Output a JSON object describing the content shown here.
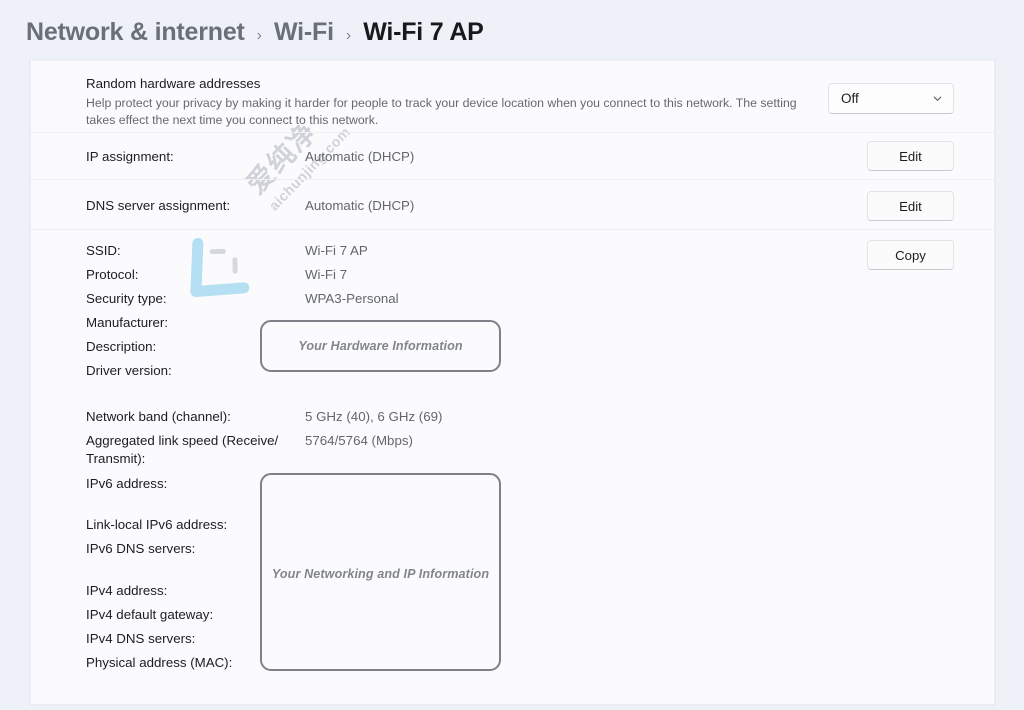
{
  "breadcrumb": {
    "items": [
      {
        "label": "Network & internet",
        "current": false
      },
      {
        "label": "Wi-Fi",
        "current": false
      },
      {
        "label": "Wi-Fi 7 AP",
        "current": true
      }
    ],
    "separator": "›"
  },
  "random_hardware": {
    "title": "Random hardware addresses",
    "description": "Help protect your privacy by making it harder for people to track your device location when you connect to this network. The setting takes effect the next time you connect to this network.",
    "dropdown_value": "Off",
    "dropdown_icon": "chevron-down-icon"
  },
  "rows": {
    "ip_assignment": {
      "label": "IP assignment:",
      "value": "Automatic (DHCP)",
      "button": "Edit"
    },
    "dns_assignment": {
      "label": "DNS server assignment:",
      "value": "Automatic (DHCP)",
      "button": "Edit"
    },
    "copy_button": "Copy",
    "ssid": {
      "label": "SSID:",
      "value": "Wi-Fi 7 AP"
    },
    "protocol": {
      "label": "Protocol:",
      "value": "Wi-Fi 7"
    },
    "security_type": {
      "label": "Security type:",
      "value": "WPA3-Personal"
    },
    "manufacturer": {
      "label": "Manufacturer:",
      "value": ""
    },
    "description": {
      "label": "Description:",
      "value": ""
    },
    "driver_version": {
      "label": "Driver version:",
      "value": ""
    },
    "network_band": {
      "label": "Network band (channel):",
      "value": "5 GHz (40), 6 GHz (69)"
    },
    "link_speed": {
      "label": "Aggregated link speed (Receive/\nTransmit):",
      "value": "5764/5764 (Mbps)"
    },
    "ipv6_address": {
      "label": "IPv6 address:",
      "value": ""
    },
    "link_local_ipv6": {
      "label": "Link-local IPv6 address:",
      "value": ""
    },
    "ipv6_dns": {
      "label": "IPv6 DNS servers:",
      "value": ""
    },
    "ipv4_address": {
      "label": "IPv4 address:",
      "value": ""
    },
    "ipv4_gateway": {
      "label": "IPv4 default gateway:",
      "value": ""
    },
    "ipv4_dns": {
      "label": "IPv4 DNS servers:",
      "value": ""
    },
    "physical_address": {
      "label": "Physical address (MAC):",
      "value": ""
    }
  },
  "redactions": {
    "hardware": "Your Hardware Information",
    "networking": "Your Networking and IP Information"
  },
  "watermark": {
    "text_cn": "爱纯净",
    "text_en": "aichunjing.com"
  },
  "colors": {
    "page_background": "#eef1f8",
    "card_background": "#fbfbfd",
    "label_text": "#1c1d1f",
    "value_text": "#62666d",
    "redaction_border": "#7e8288",
    "watermark": "#c9ccd3",
    "watermark_logo": "#a9dcf2"
  }
}
